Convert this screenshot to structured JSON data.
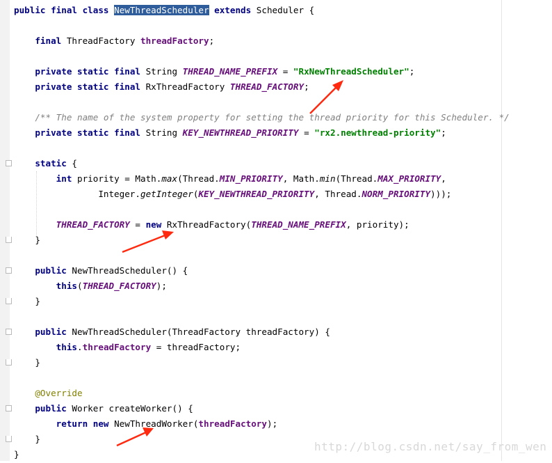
{
  "colors": {
    "keyword": "#000080",
    "string": "#008000",
    "comment": "#808080",
    "static_field": "#660e7a",
    "annotation": "#808000",
    "selection": "#2f5d9b",
    "arrow": "#ff2a10"
  },
  "editor": {
    "lines": [
      [
        {
          "t": "public final class ",
          "c": "kw"
        },
        {
          "t": "NewThreadScheduler",
          "c": "hl"
        },
        {
          "t": " "
        },
        {
          "t": "extends",
          "c": "kw"
        },
        {
          "t": " Scheduler {"
        }
      ],
      [
        {
          "t": ""
        }
      ],
      [
        {
          "t": "    "
        },
        {
          "t": "final",
          "c": "kw"
        },
        {
          "t": " ThreadFactory "
        },
        {
          "t": "threadFactory",
          "c": "fld"
        },
        {
          "t": ";"
        }
      ],
      [
        {
          "t": ""
        }
      ],
      [
        {
          "t": "    "
        },
        {
          "t": "private static final",
          "c": "kw"
        },
        {
          "t": " String "
        },
        {
          "t": "THREAD_NAME_PREFIX",
          "c": "st"
        },
        {
          "t": " = "
        },
        {
          "t": "\"RxNewThreadScheduler\"",
          "c": "str"
        },
        {
          "t": ";"
        }
      ],
      [
        {
          "t": "    "
        },
        {
          "t": "private static final",
          "c": "kw"
        },
        {
          "t": " RxThreadFactory "
        },
        {
          "t": "THREAD_FACTORY",
          "c": "st"
        },
        {
          "t": ";"
        }
      ],
      [
        {
          "t": ""
        }
      ],
      [
        {
          "t": "    "
        },
        {
          "t": "/** The name of the system property for setting the thread priority for this Scheduler. */",
          "c": "cmt"
        }
      ],
      [
        {
          "t": "    "
        },
        {
          "t": "private static final",
          "c": "kw"
        },
        {
          "t": " String "
        },
        {
          "t": "KEY_NEWTHREAD_PRIORITY",
          "c": "st"
        },
        {
          "t": " = "
        },
        {
          "t": "\"rx2.newthread-priority\"",
          "c": "str"
        },
        {
          "t": ";"
        }
      ],
      [
        {
          "t": ""
        }
      ],
      [
        {
          "t": "    "
        },
        {
          "t": "static",
          "c": "kw"
        },
        {
          "t": " {"
        }
      ],
      [
        {
          "t": "        "
        },
        {
          "t": "int",
          "c": "kw"
        },
        {
          "t": " priority = Math."
        },
        {
          "t": "max",
          "c": "mi"
        },
        {
          "t": "(Thread."
        },
        {
          "t": "MIN_PRIORITY",
          "c": "st"
        },
        {
          "t": ", Math."
        },
        {
          "t": "min",
          "c": "mi"
        },
        {
          "t": "(Thread."
        },
        {
          "t": "MAX_PRIORITY",
          "c": "st"
        },
        {
          "t": ","
        }
      ],
      [
        {
          "t": "                Integer."
        },
        {
          "t": "getInteger",
          "c": "mi"
        },
        {
          "t": "("
        },
        {
          "t": "KEY_NEWTHREAD_PRIORITY",
          "c": "st"
        },
        {
          "t": ", Thread."
        },
        {
          "t": "NORM_PRIORITY",
          "c": "st"
        },
        {
          "t": ")));"
        }
      ],
      [
        {
          "t": ""
        }
      ],
      [
        {
          "t": "        "
        },
        {
          "t": "THREAD_FACTORY",
          "c": "st"
        },
        {
          "t": " = "
        },
        {
          "t": "new",
          "c": "kw"
        },
        {
          "t": " RxThreadFactory("
        },
        {
          "t": "THREAD_NAME_PREFIX",
          "c": "st"
        },
        {
          "t": ", priority);"
        }
      ],
      [
        {
          "t": "    }"
        }
      ],
      [
        {
          "t": ""
        }
      ],
      [
        {
          "t": "    "
        },
        {
          "t": "public",
          "c": "kw"
        },
        {
          "t": " NewThreadScheduler() {"
        }
      ],
      [
        {
          "t": "        "
        },
        {
          "t": "this",
          "c": "kw"
        },
        {
          "t": "("
        },
        {
          "t": "THREAD_FACTORY",
          "c": "st"
        },
        {
          "t": ");"
        }
      ],
      [
        {
          "t": "    }"
        }
      ],
      [
        {
          "t": ""
        }
      ],
      [
        {
          "t": "    "
        },
        {
          "t": "public",
          "c": "kw"
        },
        {
          "t": " NewThreadScheduler(ThreadFactory threadFactory) {"
        }
      ],
      [
        {
          "t": "        "
        },
        {
          "t": "this",
          "c": "kw"
        },
        {
          "t": "."
        },
        {
          "t": "threadFactory",
          "c": "fld"
        },
        {
          "t": " = threadFactory;"
        }
      ],
      [
        {
          "t": "    }"
        }
      ],
      [
        {
          "t": ""
        }
      ],
      [
        {
          "t": "    "
        },
        {
          "t": "@Override",
          "c": "ann"
        }
      ],
      [
        {
          "t": "    "
        },
        {
          "t": "public",
          "c": "kw"
        },
        {
          "t": " Worker createWorker() {"
        }
      ],
      [
        {
          "t": "        "
        },
        {
          "t": "return new",
          "c": "kw"
        },
        {
          "t": " NewThreadWorker("
        },
        {
          "t": "threadFactory",
          "c": "fld"
        },
        {
          "t": ");"
        }
      ],
      [
        {
          "t": "    }"
        }
      ],
      [
        {
          "t": "}"
        }
      ]
    ]
  },
  "watermark": "http://blog.csdn.net/say_from_wen"
}
